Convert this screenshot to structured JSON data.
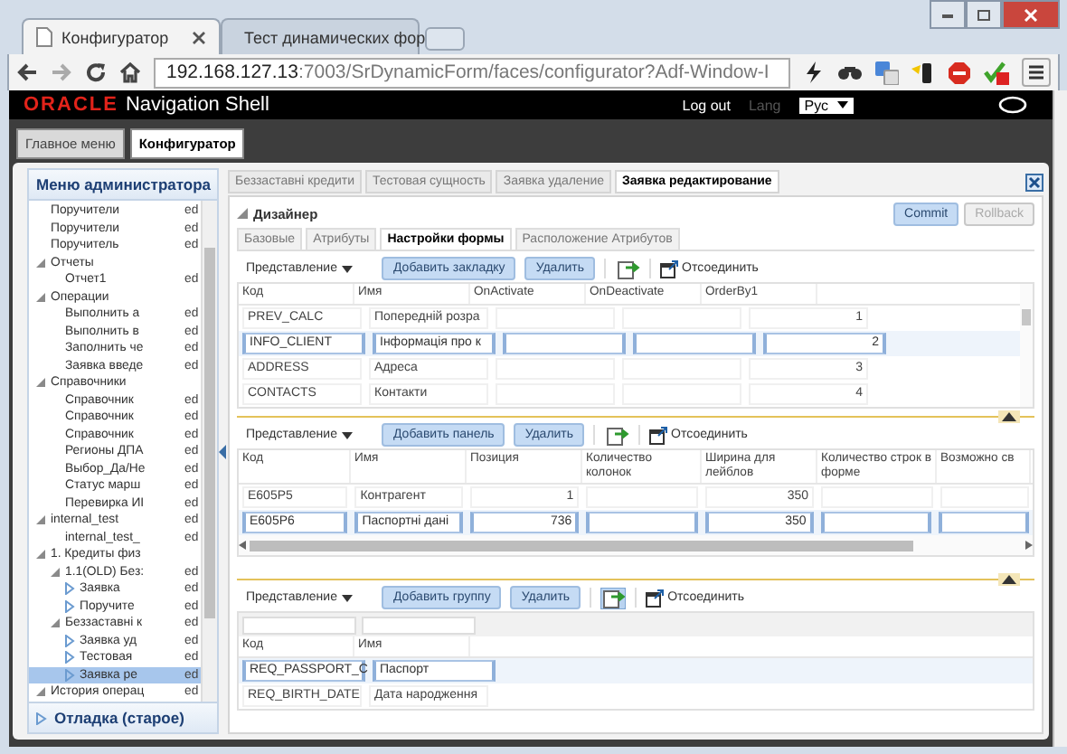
{
  "browser": {
    "tabs": [
      {
        "title": "Конфигуратор",
        "selected": true
      },
      {
        "title": "Тест динамических фор",
        "selected": false
      }
    ],
    "url_host": "192.168.127.13",
    "url_rest": ":7003/SrDynamicForm/faces/configurator?Adf-Window-I"
  },
  "header": {
    "logo": "ORACLE",
    "product": "Navigation Shell",
    "logout": "Log out",
    "lang_label": "Lang",
    "lang_value": "Рус"
  },
  "nav_tabs": [
    {
      "label": "Главное меню",
      "selected": false
    },
    {
      "label": "Конфигуратор",
      "selected": true
    }
  ],
  "sidebar": {
    "title": "Меню администратора",
    "footer": "Отладка (старое)",
    "tree": [
      {
        "label": "Поручители",
        "kind": "leaf",
        "action": "ed",
        "selected": false
      },
      {
        "label": "Поручители",
        "kind": "leaf",
        "action": "ed",
        "selected": false
      },
      {
        "label": "Поручитель",
        "kind": "leaf",
        "action": "ed",
        "selected": false
      },
      {
        "label": "Отчеты",
        "kind": "node",
        "expanded": true,
        "selected": false,
        "children": [
          {
            "label": "Отчет1",
            "kind": "leaf",
            "action": "ed",
            "selected": false
          }
        ]
      },
      {
        "label": "Операции",
        "kind": "node",
        "expanded": true,
        "selected": false,
        "children": [
          {
            "label": "Выполнить а",
            "kind": "leaf",
            "action": "ed",
            "selected": false
          },
          {
            "label": "Выполнить в",
            "kind": "leaf",
            "action": "ed",
            "selected": false
          },
          {
            "label": "Заполнить че",
            "kind": "leaf",
            "action": "ed",
            "selected": false
          },
          {
            "label": "Заявка введе",
            "kind": "leaf",
            "action": "ed",
            "selected": false
          }
        ]
      },
      {
        "label": "Справочники",
        "kind": "node",
        "expanded": true,
        "selected": false,
        "children": [
          {
            "label": "Справочник",
            "kind": "leaf",
            "action": "ed",
            "selected": false
          },
          {
            "label": "Справочник",
            "kind": "leaf",
            "action": "ed",
            "selected": false
          },
          {
            "label": "Справочник",
            "kind": "leaf",
            "action": "ed",
            "selected": false
          },
          {
            "label": "Регионы ДПА",
            "kind": "leaf",
            "action": "ed",
            "selected": false
          },
          {
            "label": "Выбор_Да/Не",
            "kind": "leaf",
            "action": "ed",
            "selected": false
          },
          {
            "label": "Статус марш",
            "kind": "leaf",
            "action": "ed",
            "selected": false
          },
          {
            "label": "Перевирка ИІ",
            "kind": "leaf",
            "action": "ed",
            "selected": false
          }
        ]
      },
      {
        "label": "internal_test",
        "kind": "node",
        "expanded": true,
        "action": "ed",
        "selected": false,
        "children": [
          {
            "label": "internal_test_",
            "kind": "leaf",
            "action": "ed",
            "selected": false
          }
        ]
      },
      {
        "label": "1. Кредиты физ",
        "kind": "node",
        "expanded": true,
        "selected": false,
        "children": [
          {
            "label": "1.1(OLD) Без:",
            "kind": "node",
            "expanded": true,
            "action": "ed",
            "selected": false,
            "children": [
              {
                "label": "Заявка",
                "kind": "node",
                "expanded": false,
                "action": "ed",
                "selected": false
              },
              {
                "label": "Поручите",
                "kind": "node",
                "expanded": false,
                "action": "ed",
                "selected": false
              }
            ]
          },
          {
            "label": "Беззаставні к",
            "kind": "node",
            "expanded": true,
            "action": "ed",
            "selected": false,
            "children": [
              {
                "label": "Заявка уд",
                "kind": "node",
                "expanded": false,
                "action": "ed",
                "selected": false
              },
              {
                "label": "Тестовая",
                "kind": "node",
                "expanded": false,
                "action": "ed",
                "selected": false
              },
              {
                "label": "Заявка ре",
                "kind": "node",
                "expanded": false,
                "action": "ed",
                "selected": true
              }
            ]
          }
        ]
      },
      {
        "label": "История операц",
        "kind": "node",
        "expanded": true,
        "action": "ed",
        "selected": false
      }
    ]
  },
  "main": {
    "tabs": [
      {
        "label": "Беззаставні кредити",
        "selected": false
      },
      {
        "label": "Тестовая сущность",
        "selected": false
      },
      {
        "label": "Заявка удаление",
        "selected": false
      },
      {
        "label": "Заявка редактирование",
        "selected": true
      }
    ],
    "section_title": "Дизайнер",
    "commit": "Commit",
    "rollback": {
      "label": "Rollback",
      "disabled": true
    },
    "subtabs": [
      {
        "label": "Базовые",
        "selected": false
      },
      {
        "label": "Атрибуты",
        "selected": false
      },
      {
        "label": "Настройки формы",
        "selected": true
      },
      {
        "label": "Расположение Атрибутов",
        "selected": false
      }
    ],
    "grids": [
      {
        "view_menu": "Представление",
        "add_button": "Добавить закладку",
        "delete_button": "Удалить",
        "export_active": false,
        "detach": "Отсоединить",
        "vertical_scroll": true,
        "columns": [
          {
            "label": "Код",
            "kind": "text"
          },
          {
            "label": "Имя",
            "kind": "text"
          },
          {
            "label": "OnActivate",
            "kind": "text"
          },
          {
            "label": "OnDeactivate",
            "kind": "text"
          },
          {
            "label": "OrderBy1",
            "kind": "number"
          }
        ],
        "rows": [
          {
            "selected": false,
            "cells": [
              "PREV_CALC",
              "Попередній розра",
              null,
              null,
              "1"
            ]
          },
          {
            "selected": true,
            "cells": [
              "INFO_CLIENT",
              "Інформація про к",
              null,
              null,
              "2"
            ]
          },
          {
            "selected": false,
            "cells": [
              "ADDRESS",
              "Адреса",
              null,
              null,
              "3"
            ]
          },
          {
            "selected": false,
            "cells": [
              "CONTACTS",
              "Контакти",
              null,
              null,
              "4"
            ]
          }
        ]
      },
      {
        "view_menu": "Представление",
        "add_button": "Добавить панель",
        "delete_button": "Удалить",
        "export_active": false,
        "detach": "Отсоединить",
        "horizontal_scroll": true,
        "columns": [
          {
            "label": "Код",
            "kind": "text"
          },
          {
            "label": "Имя",
            "kind": "text"
          },
          {
            "label": "Позиция",
            "kind": "number"
          },
          {
            "label": "Количество колонок",
            "kind": "text"
          },
          {
            "label": "Ширина для лейблов",
            "kind": "number"
          },
          {
            "label": "Количество строк в форме",
            "kind": "text"
          },
          {
            "label": "Возможно св",
            "kind": "text"
          }
        ],
        "rows": [
          {
            "selected": false,
            "cells": [
              "E605P5",
              "Контрагент",
              "1",
              null,
              "350",
              null,
              null
            ]
          },
          {
            "selected": true,
            "cells": [
              "E605P6",
              "Паспортні дані",
              "736",
              null,
              "350",
              null,
              null
            ]
          }
        ]
      },
      {
        "view_menu": "Представление",
        "add_button": "Добавить группу",
        "delete_button": "Удалить",
        "export_active": true,
        "detach": "Отсоединить",
        "filter_row": true,
        "columns": [
          {
            "label": "Код",
            "kind": "text"
          },
          {
            "label": "Имя",
            "kind": "text"
          }
        ],
        "rows": [
          {
            "selected": true,
            "cells": [
              "REQ_PASSPORT_C",
              "Паспорт"
            ]
          },
          {
            "selected": false,
            "cells": [
              "REQ_BIRTH_DATE",
              "Дата народження"
            ]
          }
        ]
      }
    ]
  }
}
